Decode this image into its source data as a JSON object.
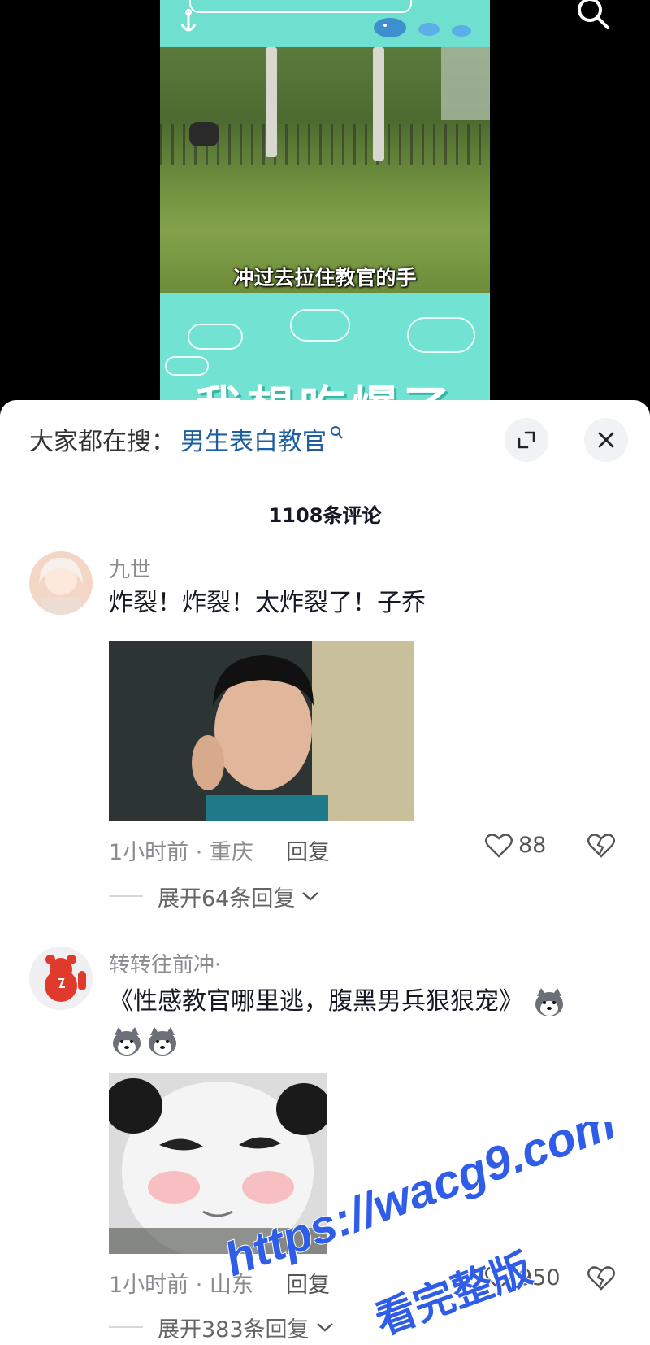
{
  "video": {
    "caption": "冲过去拉住教官的手",
    "bottom_text": "我想吃爆了"
  },
  "header": {
    "hot_search_prefix": "大家都在搜：",
    "hot_search_term": "男生表白教官"
  },
  "comments_header": {
    "count_label": "1108条评论"
  },
  "comments": [
    {
      "username": "九世",
      "text": "炸裂！炸裂！太炸裂了！子乔",
      "time_location": "1小时前 · 重庆",
      "reply_label": "回复",
      "likes": "88",
      "expand_label": "展开64条回复"
    },
    {
      "username": "转转往前冲·",
      "text": "《性感教官哪里逃，腹黑男兵狠狠宠》",
      "time_location": "1小时前 · 山东",
      "reply_label": "回复",
      "likes": "950",
      "expand_label": "展开383条回复"
    }
  ],
  "watermark": {
    "url": "https://wacg9.com",
    "text": "看完整版"
  },
  "colors": {
    "video_teal": "#6fe0cf",
    "link_blue": "#1e5fa0",
    "text_primary": "#161823",
    "text_secondary": "#8a8a8f",
    "watermark_blue": "#2f5de8"
  },
  "icons": [
    "search-icon",
    "small-search-icon",
    "expand-icon",
    "close-icon",
    "heart-icon",
    "broken-heart-icon",
    "chevron-down-icon",
    "husky-emoji-icon"
  ]
}
